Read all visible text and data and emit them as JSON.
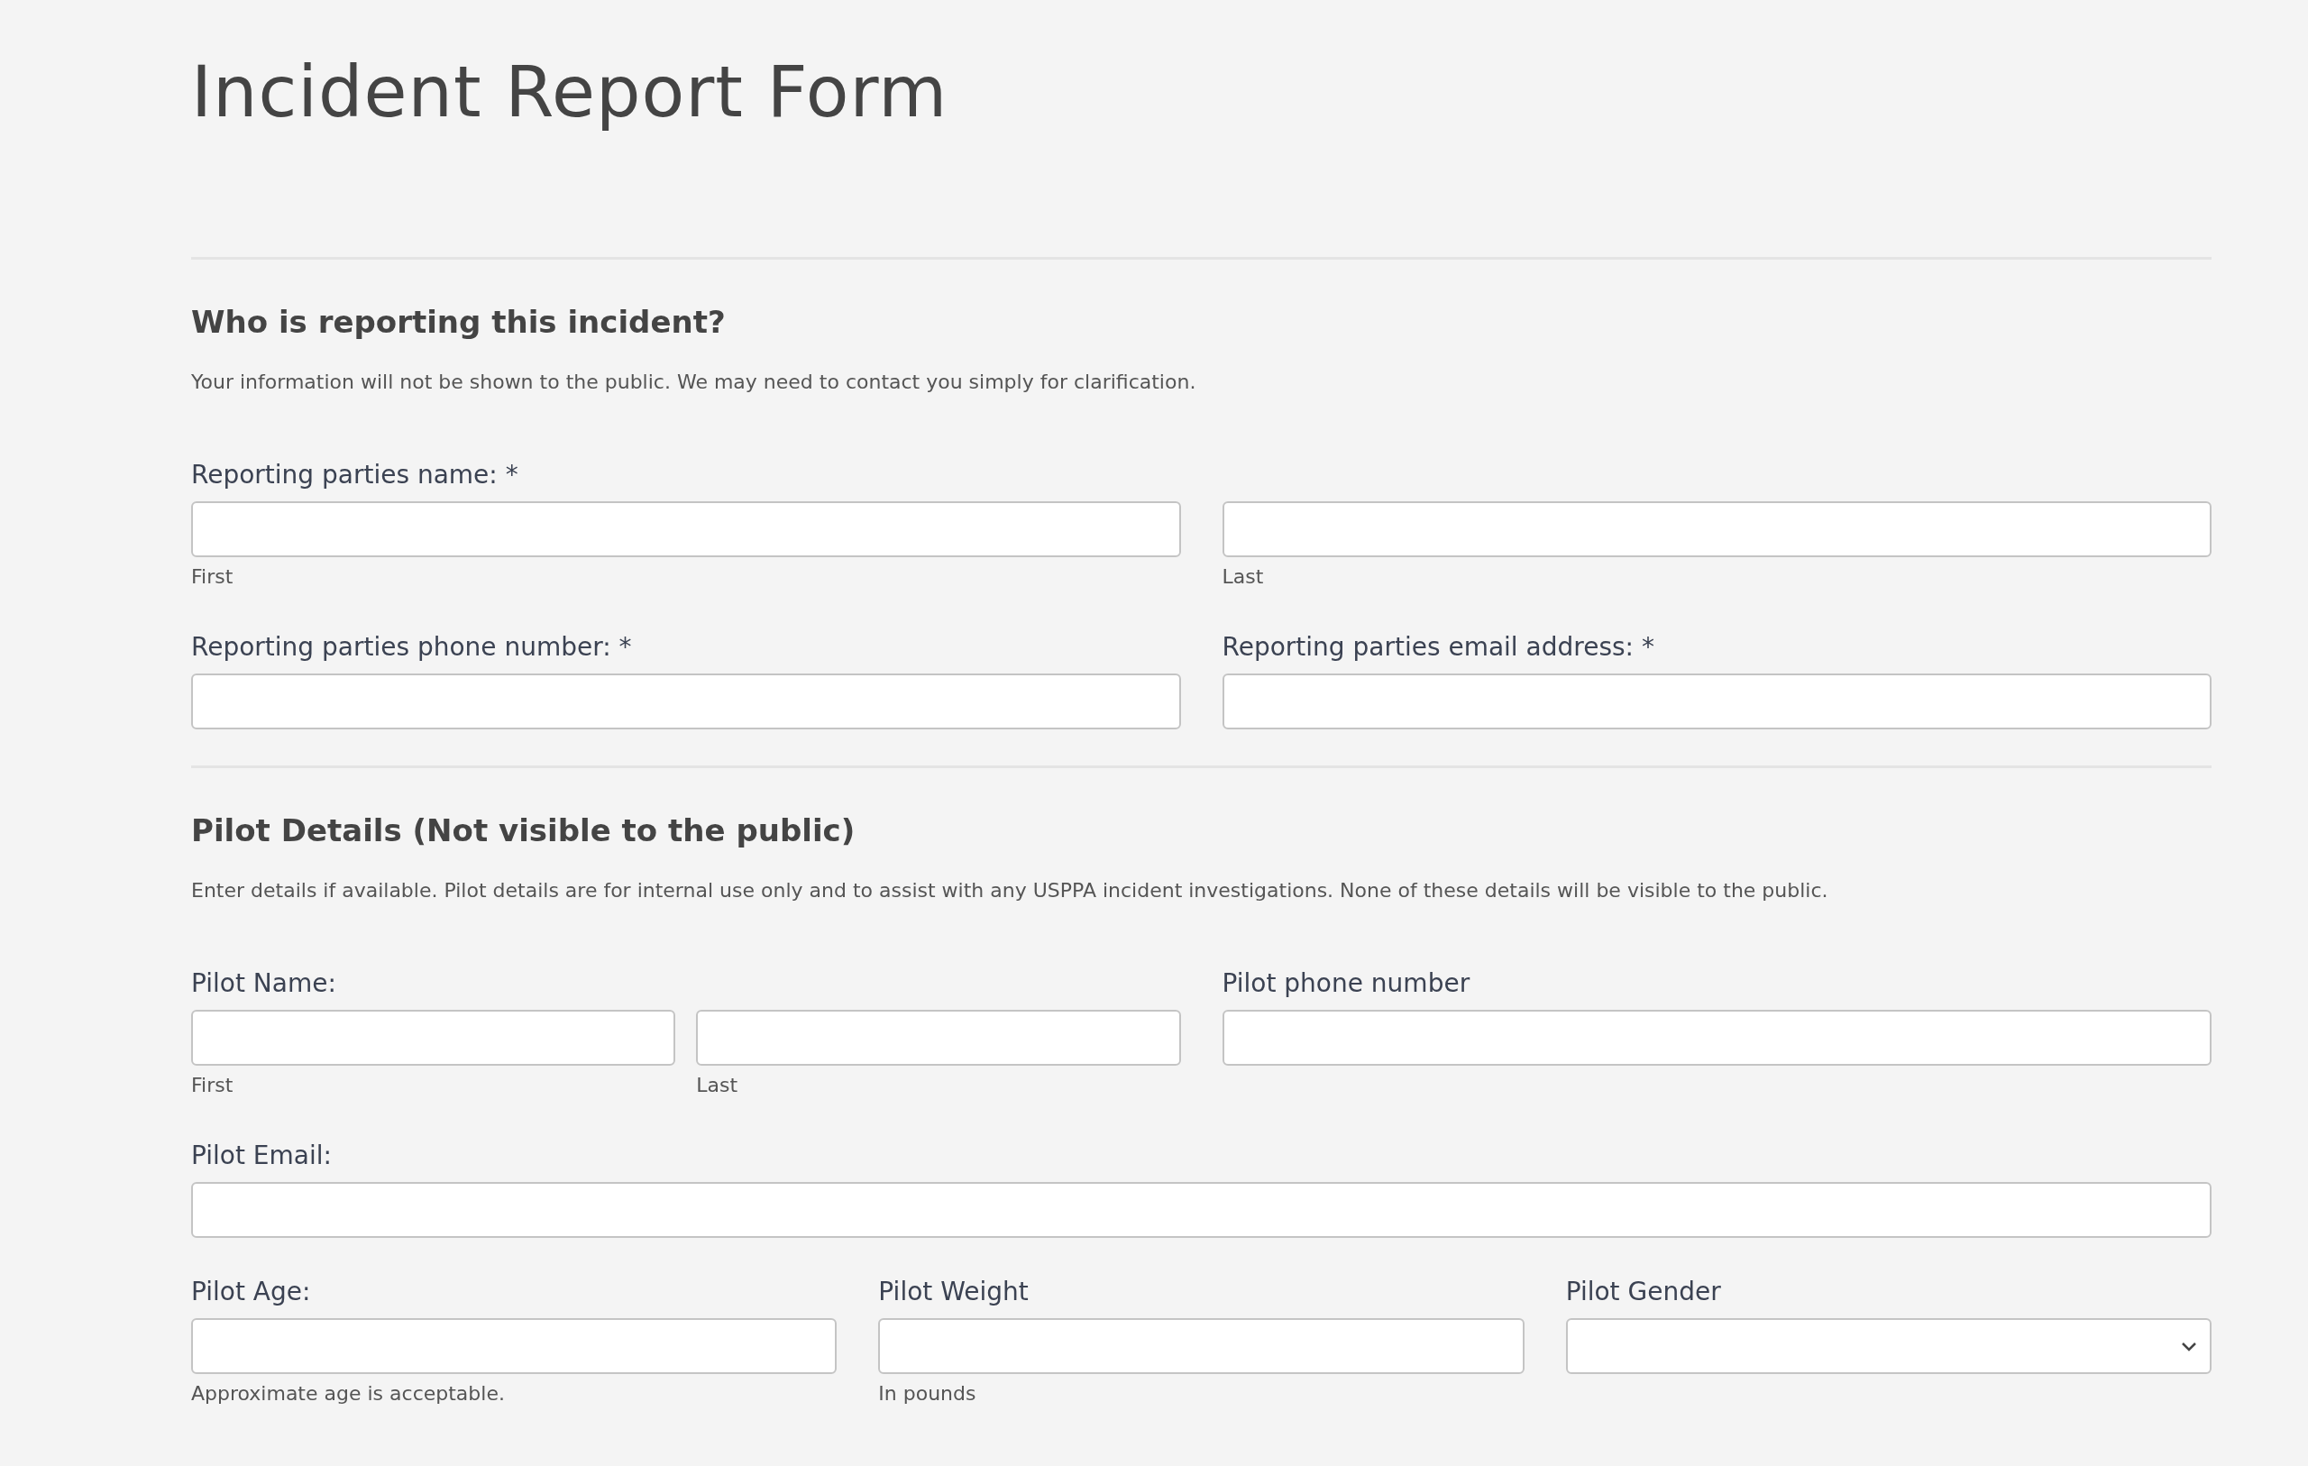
{
  "title": "Incident Report Form",
  "sections": [
    {
      "heading": "Who is reporting this incident?",
      "description": "Your information will not be shown to the public. We may need to contact you simply for clarification.",
      "rows": [
        [
          {
            "label": "Reporting parties name: *",
            "inputs": [
              {
                "kind": "text",
                "sublabel": "First"
              },
              {
                "kind": "text",
                "sublabel": "Last"
              }
            ]
          }
        ],
        [
          {
            "label": "Reporting parties phone number: *",
            "inputs": [
              {
                "kind": "text"
              }
            ]
          },
          {
            "label": "Reporting parties email address: *",
            "inputs": [
              {
                "kind": "text"
              }
            ]
          }
        ]
      ]
    },
    {
      "heading": "Pilot Details (Not visible to the public)",
      "description": "Enter details if available. Pilot details are for internal use only and to assist with any USPPA incident investigations. None of these details will be visible to the public.",
      "rows": [
        [
          {
            "label": "Pilot Name:",
            "inputs": [
              {
                "kind": "text",
                "sublabel": "First"
              },
              {
                "kind": "text",
                "sublabel": "Last"
              }
            ]
          },
          {
            "label": "Pilot phone number",
            "inputs": [
              {
                "kind": "text"
              }
            ]
          }
        ],
        [
          {
            "label": "Pilot Email:",
            "inputs": [
              {
                "kind": "text"
              }
            ]
          }
        ],
        [
          {
            "label": "Pilot Age:",
            "inputs": [
              {
                "kind": "text",
                "sublabel": "Approximate age is acceptable."
              }
            ]
          },
          {
            "label": "Pilot Weight",
            "inputs": [
              {
                "kind": "text",
                "sublabel": "In pounds"
              }
            ]
          },
          {
            "label": "Pilot Gender",
            "inputs": [
              {
                "kind": "select"
              }
            ]
          }
        ]
      ]
    }
  ]
}
